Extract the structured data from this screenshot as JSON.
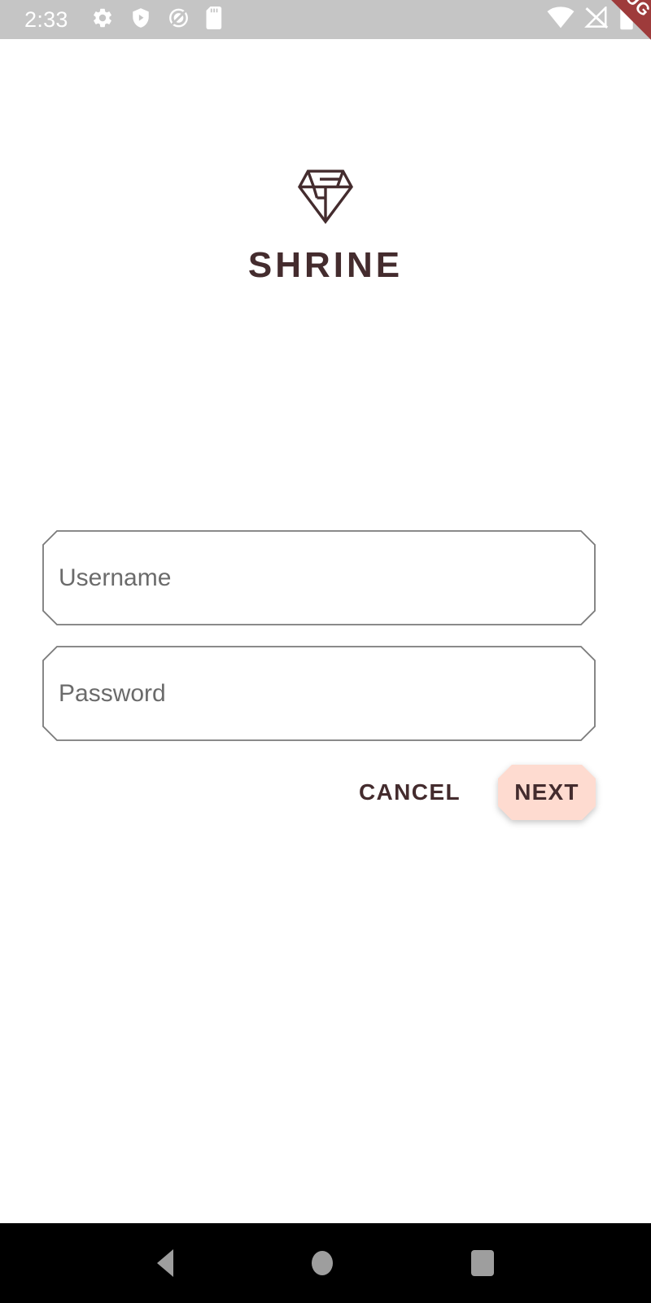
{
  "status_bar": {
    "time": "2:33",
    "background_color": "#C5C5C5",
    "icon_color": "#FFFFFF",
    "left_icons": [
      "gear-icon",
      "shield-play-icon",
      "no-entry-slash-icon",
      "sd-card-icon"
    ],
    "right_icons": [
      "wifi-icon",
      "cellular-off-icon",
      "battery-icon"
    ]
  },
  "debug_banner": {
    "label": "DEBUG",
    "color": "#9E3B3B",
    "text_color": "#FFFFFF"
  },
  "branding": {
    "logo_name": "shrine-diamond-logo",
    "title": "SHRINE",
    "primary_color": "#442C2E"
  },
  "form": {
    "username": {
      "placeholder": "Username",
      "value": ""
    },
    "password": {
      "placeholder": "Password",
      "value": ""
    },
    "border_color": "#7A7A7A",
    "placeholder_color": "#6B6B6B"
  },
  "actions": {
    "cancel_label": "CANCEL",
    "next_label": "NEXT",
    "next_background_color": "#FEDBD0",
    "text_color": "#442C2E"
  },
  "nav_bar": {
    "background_color": "#000000",
    "icon_color": "#9E9E9E",
    "buttons": [
      "back-button",
      "home-button",
      "recents-button"
    ]
  }
}
